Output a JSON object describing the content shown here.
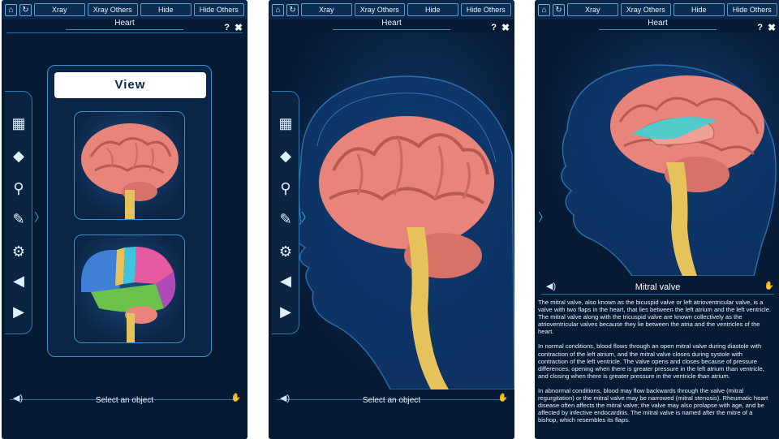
{
  "toolbar": {
    "buttons": [
      "Xray",
      "Xray Others",
      "Hide",
      "Hide Others"
    ],
    "home_icon": "home-icon",
    "refresh_icon": "refresh-icon"
  },
  "screen1": {
    "title": "Heart",
    "help": "?",
    "close": "✖",
    "view_label": "View",
    "footer": "Select an object"
  },
  "screen2": {
    "title": "Heart",
    "help": "?",
    "close": "✖",
    "footer": "Select an object"
  },
  "screen3": {
    "title": "Heart",
    "help": "?",
    "close": "✖",
    "heading": "Mitral valve",
    "paragraphs": [
      "The mitral valve, also known as the bicuspid valve or left atrioventricular valve, is a valve with two flaps in the heart, that lies between the left atrium and the left ventricle. The mitral valve along with the tricuspid valve are known collectively as the atrioventricular valves because they lie between the atria and the ventricles of the heart.",
      "In normal conditions, blood flows through an open mitral valve during diastole with contraction of the left atrium, and the mitral valve closes during systole with contraction of the left ventricle. The valve opens and closes because of pressure differences, opening when there is greater pressure in the left atrium than ventricle, and closing when there is greater pressure in the ventricle than atrium.",
      "In abnormal conditions, blood may flow backwards through the valve (mitral regurgitation) or the mitral valve may be narrowed (mitral stenosis). Rheumatic heart disease often affects the mitral valve; the valve may also prolapse with age, and be affected by infective endocarditis. The mitral valve is named after the mitre of a bishop, which resembles its flaps."
    ]
  },
  "sidebar_icons": [
    "grid-icon",
    "cards-icon",
    "search-icon",
    "draw-icon",
    "gear-icon",
    "sound-icon",
    "play-icon"
  ],
  "colors": {
    "background": "#071a33",
    "accent": "#3c8fcc",
    "brain": "#e8847a",
    "spinal": "#e6c25a",
    "highlight": "#3fd0d0"
  }
}
